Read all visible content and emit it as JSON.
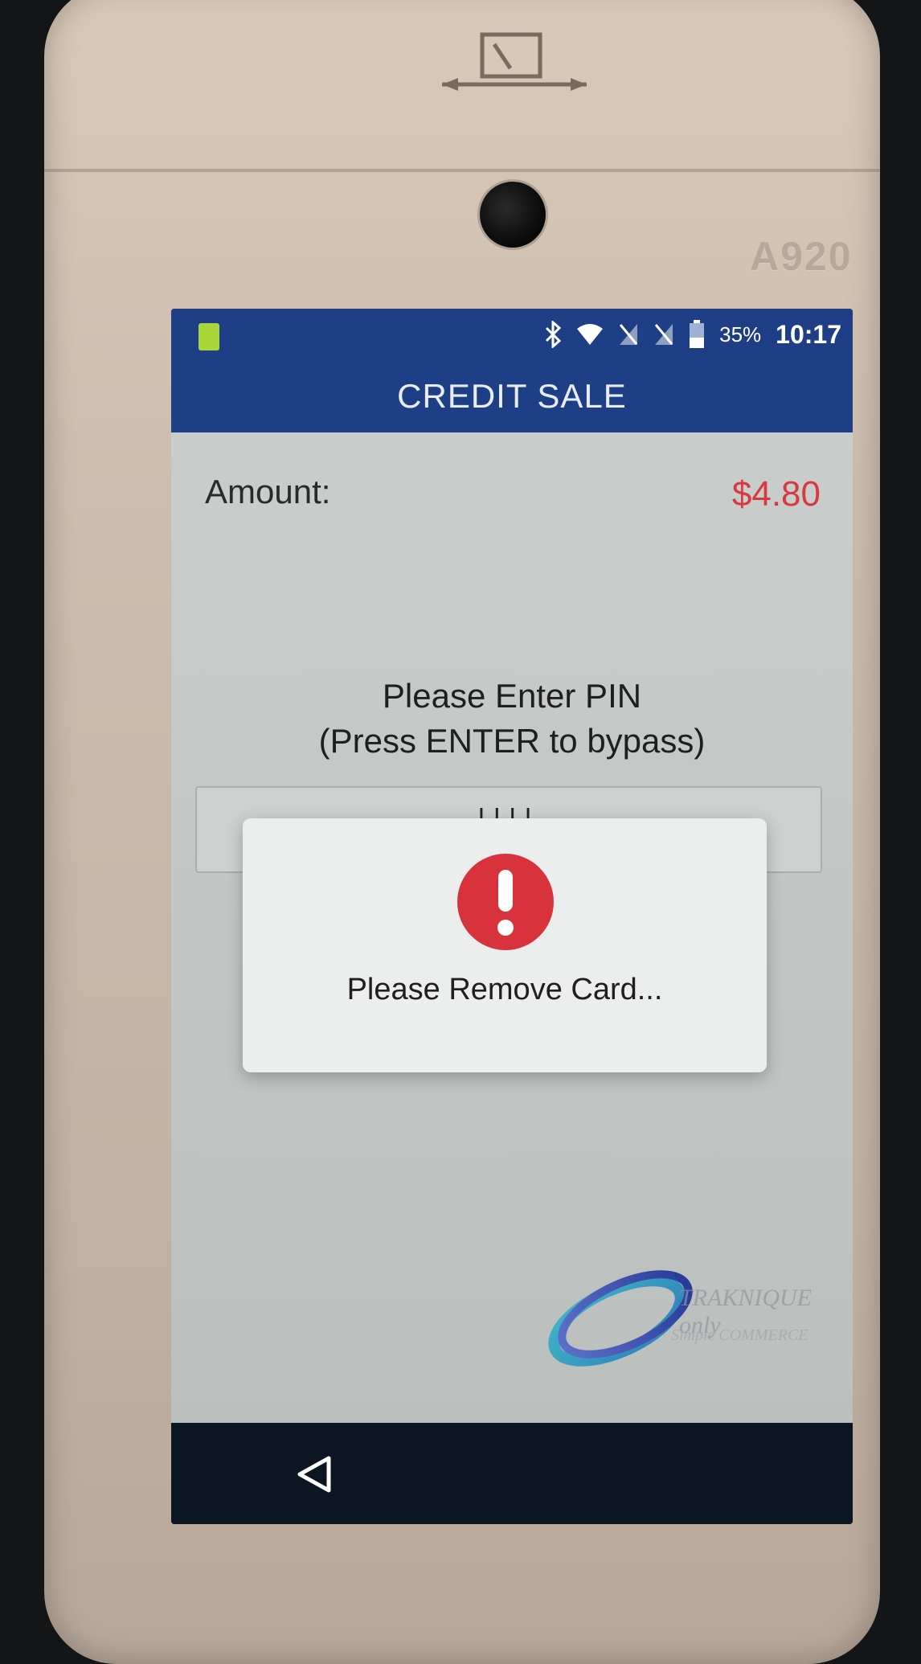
{
  "device": {
    "model_label": "A920"
  },
  "status_bar": {
    "battery_percent": "35%",
    "time": "10:17",
    "icons": [
      "sim-card-icon",
      "bluetooth-icon",
      "wifi-icon",
      "no-sim-icon",
      "no-sim-icon",
      "battery-icon"
    ]
  },
  "header": {
    "title": "CREDIT SALE"
  },
  "transaction": {
    "amount_label": "Amount:",
    "amount_value": "$4.80",
    "pin_prompt_line1": "Please Enter PIN",
    "pin_prompt_line2": "(Press ENTER to bypass)",
    "pin_value": "||||"
  },
  "dialog": {
    "icon": "alert-icon",
    "message": "Please Remove Card..."
  },
  "nav": {
    "back_icon": "back-triangle-icon"
  },
  "colors": {
    "header_blue": "#1e3f86",
    "amount_red": "#d8393f",
    "alert_red": "#d8323c"
  }
}
